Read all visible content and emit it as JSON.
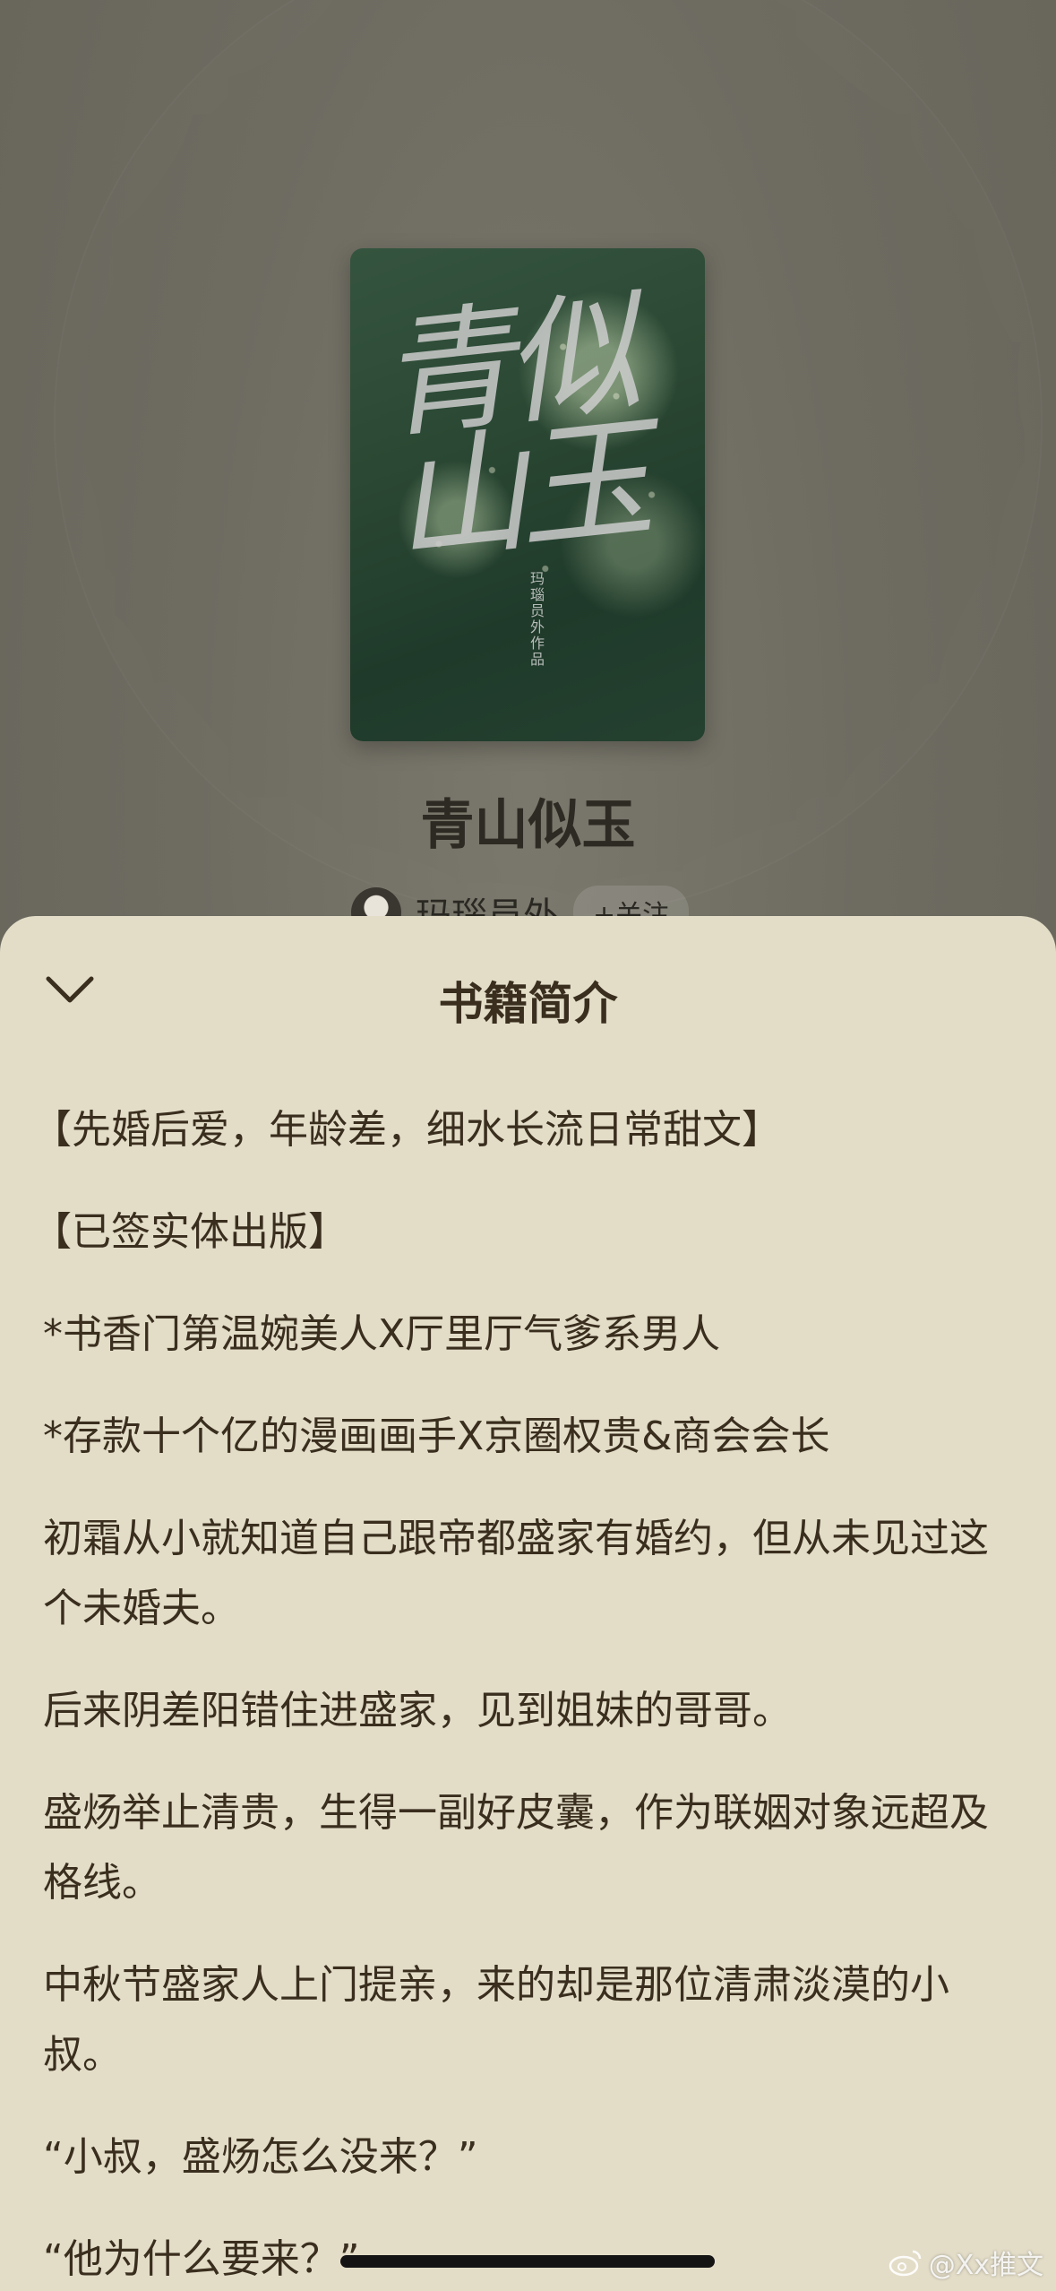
{
  "background": {
    "book": {
      "title": "青山似玉",
      "cover_title": "青似山玉",
      "cover_author": "玛瑙员外作品",
      "author_name": "玛瑙员外",
      "follow_label": "+关注"
    }
  },
  "sheet": {
    "title": "书籍简介",
    "close_icon": "chevron-down-icon",
    "paragraphs": [
      "【先婚后爱，年龄差，细水长流日常甜文】",
      "【已签实体出版】",
      "*书香门第温婉美人X厅里厅气爹系男人",
      "*存款十个亿的漫画画手X京圈权贵&商会会长",
      "初霜从小就知道自己跟帝都盛家有婚约，但从未见过这个未婚夫。",
      "后来阴差阳错住进盛家，见到姐妹的哥哥。",
      "盛炀举止清贵，生得一副好皮囊，作为联姻对象远超及格线。",
      "中秋节盛家人上门提亲，来的却是那位清肃淡漠的小叔。",
      "“小叔，盛炀怎么没来？”",
      "“他为什么要来？”"
    ]
  },
  "watermark": {
    "text": "@Xx推文",
    "icon": "weibo-icon"
  },
  "colors": {
    "sheet_bg": "#e3ddc8",
    "text": "#3a2e1e",
    "overlay_bg": "#6b6a5f"
  }
}
